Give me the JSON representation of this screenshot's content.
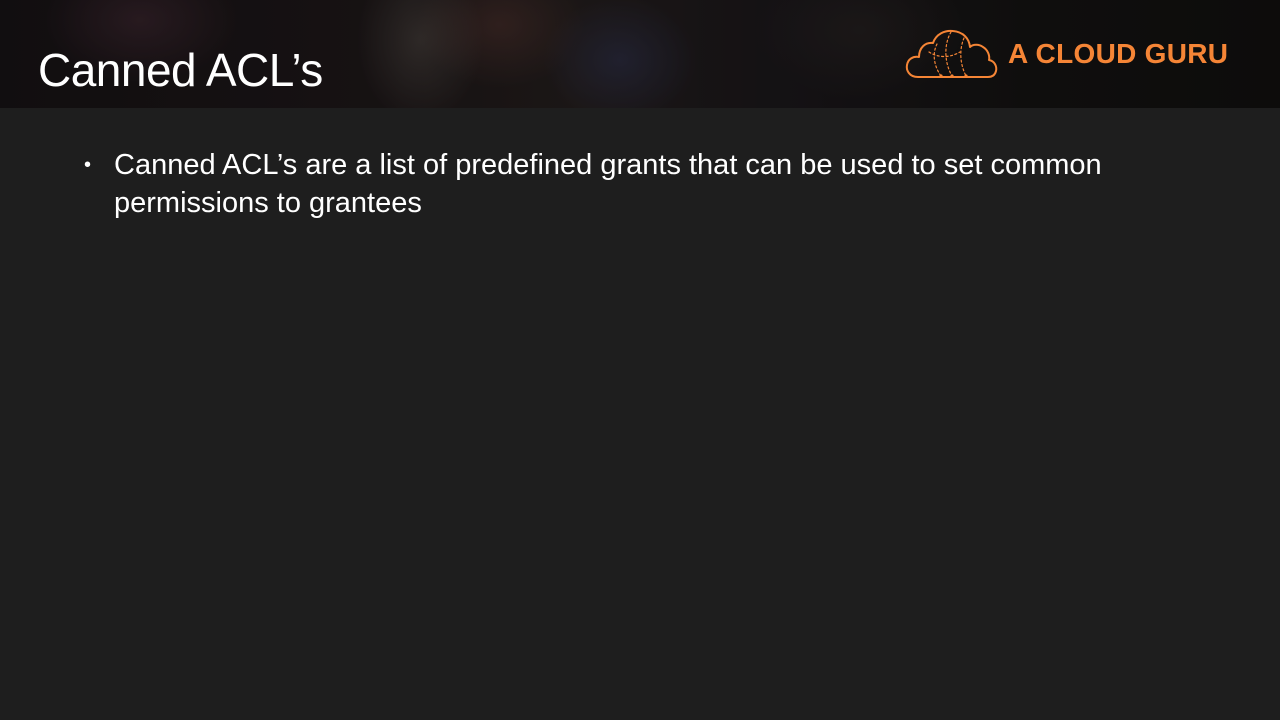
{
  "slide": {
    "title": "Canned ACL’s",
    "brand": {
      "name": "A CLOUD GURU",
      "icon": "cloud-logo-icon",
      "color": "#f58536"
    },
    "bullets": [
      {
        "marker": "•",
        "text": "Canned ACL’s are a list of predefined grants that can be used to set common permissions to grantees"
      }
    ]
  },
  "colors": {
    "background": "#1e1e1e",
    "text": "#ffffff",
    "accent": "#f58536"
  }
}
